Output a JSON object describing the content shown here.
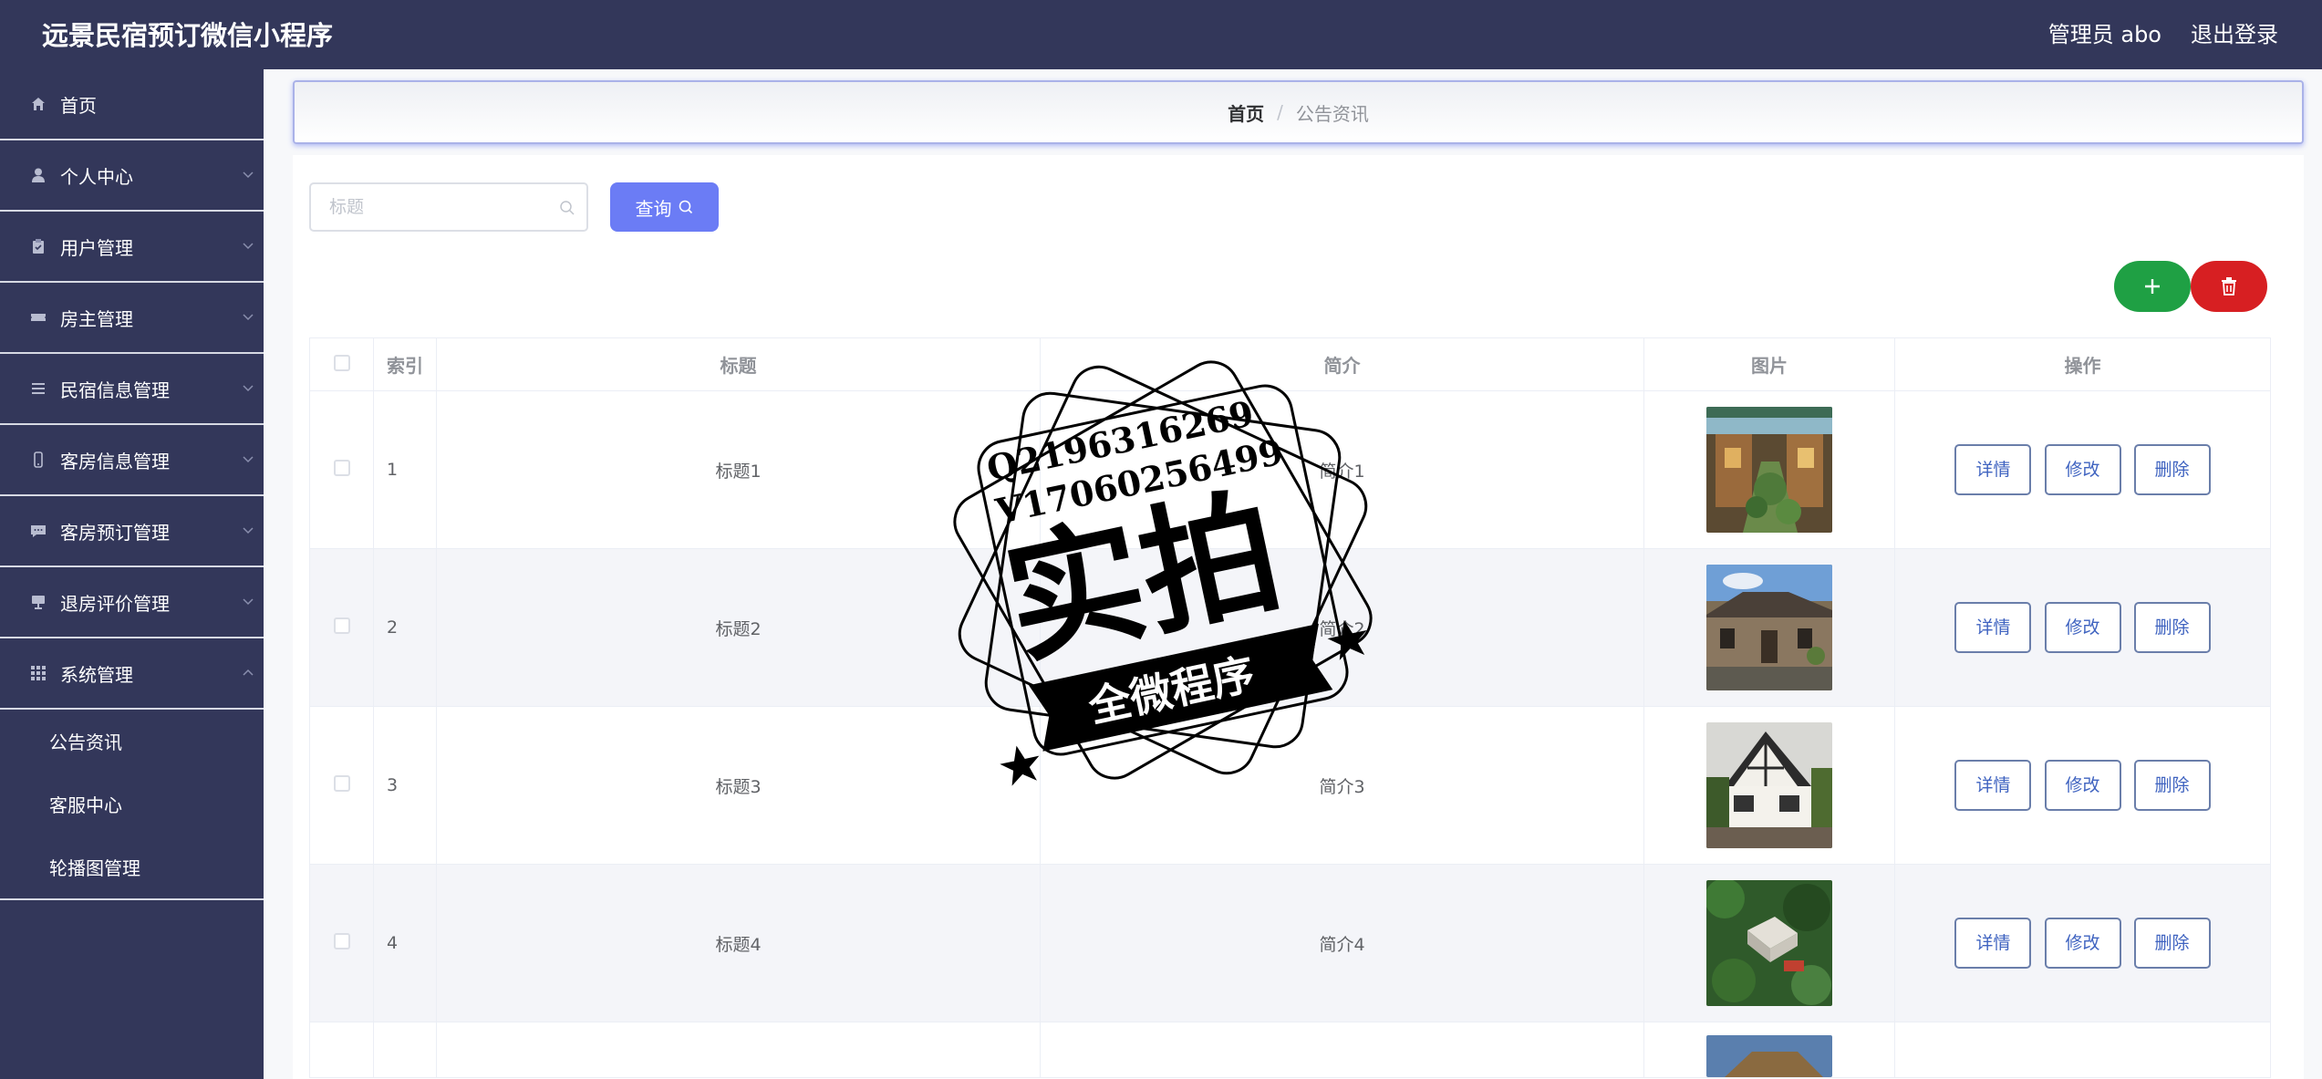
{
  "app": {
    "title": "远景民宿预订微信小程序"
  },
  "header": {
    "user_label": "管理员 abo",
    "logout_label": "退出登录"
  },
  "sidebar": {
    "items": [
      {
        "label": "首页",
        "icon": "home-icon",
        "has_arrow": false
      },
      {
        "label": "个人中心",
        "icon": "user-icon",
        "has_arrow": true
      },
      {
        "label": "用户管理",
        "icon": "clipboard-icon",
        "has_arrow": true
      },
      {
        "label": "房主管理",
        "icon": "ticket-icon",
        "has_arrow": true
      },
      {
        "label": "民宿信息管理",
        "icon": "list-icon",
        "has_arrow": true
      },
      {
        "label": "客房信息管理",
        "icon": "phone-icon",
        "has_arrow": true
      },
      {
        "label": "客房预订管理",
        "icon": "chat-icon",
        "has_arrow": true
      },
      {
        "label": "退房评价管理",
        "icon": "stand-icon",
        "has_arrow": true
      },
      {
        "label": "系统管理",
        "icon": "grid-icon",
        "has_arrow": true,
        "expanded": true
      }
    ],
    "sub_items": [
      {
        "label": "公告资讯"
      },
      {
        "label": "客服中心"
      },
      {
        "label": "轮播图管理"
      }
    ]
  },
  "breadcrumb": {
    "home": "首页",
    "separator": "/",
    "current": "公告资讯"
  },
  "search": {
    "placeholder": "标题",
    "value": "",
    "button_label": "查询"
  },
  "table": {
    "headers": {
      "index": "索引",
      "title": "标题",
      "summary": "简介",
      "image": "图片",
      "actions": "操作"
    },
    "action_labels": {
      "detail": "详情",
      "edit": "修改",
      "delete": "删除"
    },
    "rows": [
      {
        "index": "1",
        "title": "标题1",
        "summary": "简介1",
        "image": "courtyard-photo"
      },
      {
        "index": "2",
        "title": "标题2",
        "summary": "简介2",
        "image": "stone-house-photo"
      },
      {
        "index": "3",
        "title": "标题3",
        "summary": "简介3",
        "image": "tudor-house-photo"
      },
      {
        "index": "4",
        "title": "标题4",
        "summary": "简介4",
        "image": "aerial-villa-photo"
      }
    ]
  },
  "watermark": {
    "qq": "Q2196316269",
    "wechat": "V17060256499",
    "main_text": "实拍",
    "ribbon_text": "全微程序"
  },
  "colors": {
    "sidebar_bg": "#33375a",
    "query_button": "#6b7cf5",
    "add_button": "#1fa044",
    "delete_button": "#d71f22",
    "action_button_text": "#3f63c0"
  }
}
